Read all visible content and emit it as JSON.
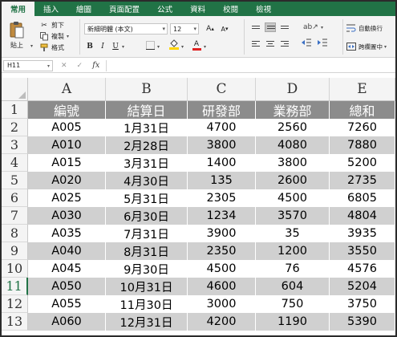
{
  "ribbon_tabs": [
    "常用",
    "插入",
    "繪圖",
    "頁面配置",
    "公式",
    "資料",
    "校閱",
    "檢視"
  ],
  "clipboard": {
    "paste_label": "貼上",
    "cut_label": "剪下",
    "copy_label": "複製",
    "format_label": "格式"
  },
  "font": {
    "name": "新細明體 (本文)",
    "size": "12",
    "grow": "A",
    "shrink": "A",
    "bold": "B",
    "italic": "I",
    "underline": "U",
    "font_color_glyph": "A"
  },
  "alignment": {
    "wrap_label": "自動換行",
    "merge_label": "跨欄置中"
  },
  "formula_bar": {
    "name_box": "H11",
    "cancel": "✕",
    "enter": "✓",
    "fx": "fx",
    "formula": ""
  },
  "columns": [
    "A",
    "B",
    "C",
    "D",
    "E"
  ],
  "row_numbers": [
    "1",
    "2",
    "3",
    "4",
    "5",
    "6",
    "7",
    "8",
    "9",
    "10",
    "11",
    "12",
    "13"
  ],
  "selected_row": "11",
  "table": {
    "headers": [
      "編號",
      "結算日",
      "研發部",
      "業務部",
      "總和"
    ],
    "rows": [
      [
        "A005",
        "1月31日",
        "4700",
        "2560",
        "7260"
      ],
      [
        "A010",
        "2月28日",
        "3800",
        "4080",
        "7880"
      ],
      [
        "A015",
        "3月31日",
        "1400",
        "3800",
        "5200"
      ],
      [
        "A020",
        "4月30日",
        "135",
        "2600",
        "2735"
      ],
      [
        "A025",
        "5月31日",
        "2305",
        "4500",
        "6805"
      ],
      [
        "A030",
        "6月30日",
        "1234",
        "3570",
        "4804"
      ],
      [
        "A035",
        "7月31日",
        "3900",
        "35",
        "3935"
      ],
      [
        "A040",
        "8月31日",
        "2350",
        "1200",
        "3550"
      ],
      [
        "A045",
        "9月30日",
        "4500",
        "76",
        "4576"
      ],
      [
        "A050",
        "10月31日",
        "4600",
        "604",
        "5204"
      ],
      [
        "A055",
        "11月30日",
        "3000",
        "750",
        "3750"
      ],
      [
        "A060",
        "12月31日",
        "4200",
        "1190",
        "5390"
      ]
    ]
  },
  "colors": {
    "ribbon_green": "#217346",
    "header_fill": "#8c8c8c",
    "band_fill": "#d0d0d0"
  }
}
